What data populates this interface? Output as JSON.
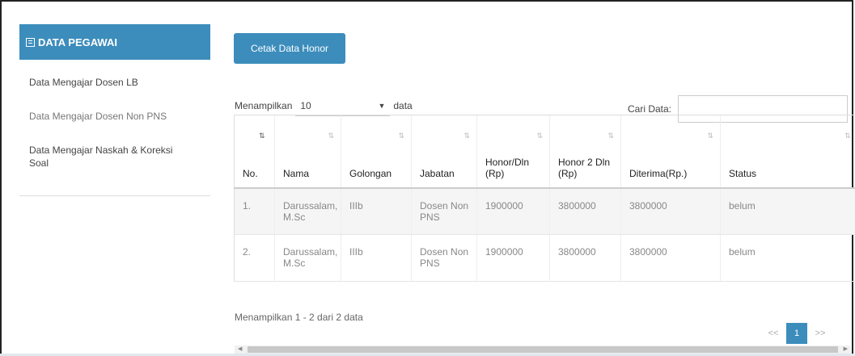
{
  "sidebar": {
    "header": "DATA PEGAWAI",
    "items": [
      {
        "label": "Data Mengajar Dosen LB"
      },
      {
        "label": "Data Mengajar Dosen Non PNS"
      },
      {
        "label": "Data Mengajar Naskah & Koreksi Soal"
      }
    ]
  },
  "toolbar": {
    "print_label": "Cetak Data Honor"
  },
  "length": {
    "prefix": "Menampilkan",
    "value": "10",
    "suffix": "data"
  },
  "search": {
    "label": "Cari Data:",
    "value": ""
  },
  "table": {
    "headers": [
      "No.",
      "Nama",
      "Golongan",
      "Jabatan",
      "Honor/Dln (Rp)",
      "Honor 2 Dln (Rp)",
      "Diterima(Rp.)",
      "Status"
    ],
    "rows": [
      [
        "1.",
        "Darussalam, M.Sc",
        "IIIb",
        "Dosen Non PNS",
        "1900000",
        "3800000",
        "3800000",
        "belum"
      ],
      [
        "2.",
        "Darussalam, M.Sc",
        "IIIb",
        "Dosen Non PNS",
        "1900000",
        "3800000",
        "3800000",
        "belum"
      ]
    ]
  },
  "info": "Menampilkan 1 - 2 dari 2 data",
  "pager": {
    "prev": "<<",
    "current": "1",
    "next": ">>"
  },
  "colors": {
    "primary": "#3c8dbc"
  }
}
